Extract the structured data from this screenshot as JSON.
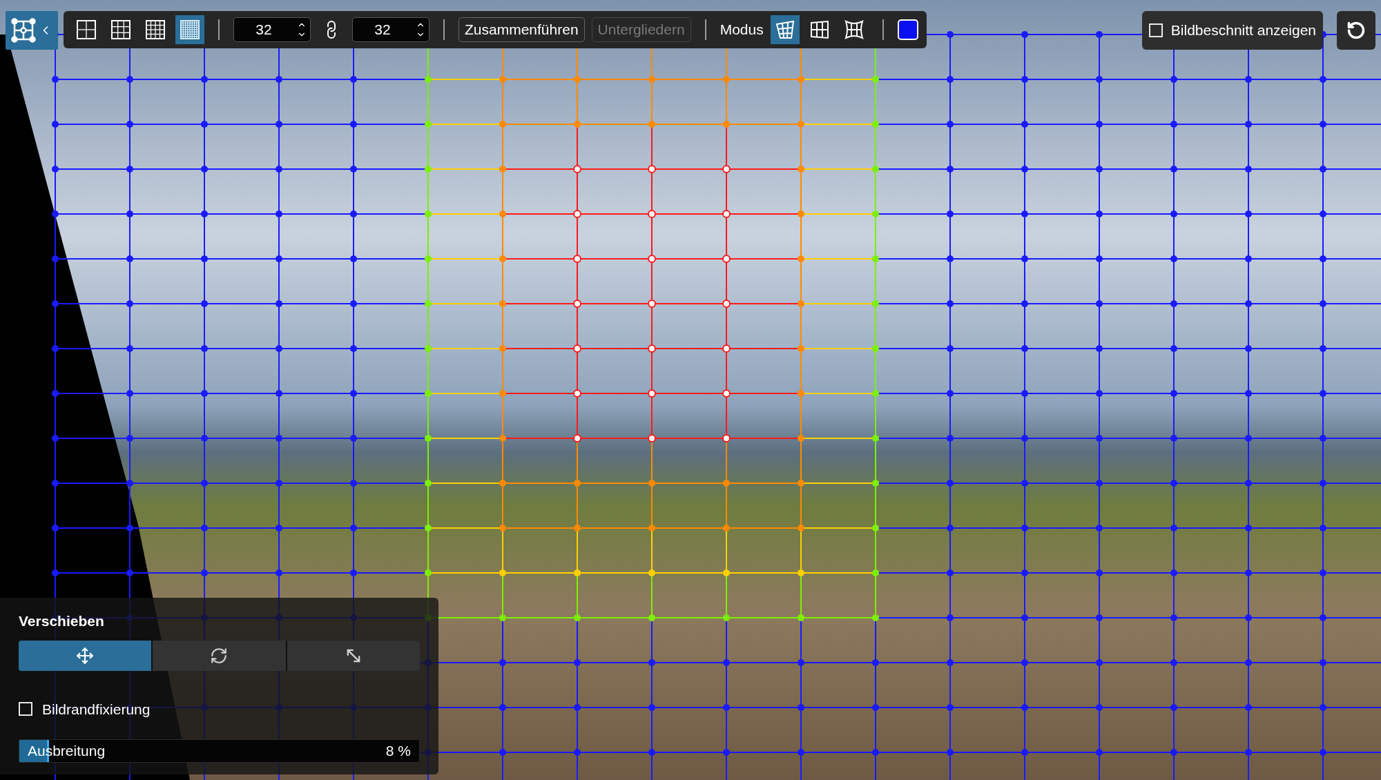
{
  "toolbar": {
    "mesh_tool": {
      "selected": true
    },
    "grid_presets": [
      {
        "selected": false
      },
      {
        "selected": false
      },
      {
        "selected": false
      },
      {
        "selected": true
      }
    ],
    "columns": {
      "value": "32"
    },
    "rows_linked": true,
    "rows": {
      "value": "32"
    },
    "buttons": [
      {
        "label": "Zusammenführen",
        "disabled": false
      },
      {
        "label": "Untergliedern",
        "disabled": true
      }
    ],
    "mode_label": "Modus",
    "modes": [
      {
        "kind": "perspective",
        "selected": true
      },
      {
        "kind": "grid",
        "selected": false
      },
      {
        "kind": "bulge",
        "selected": false
      }
    ],
    "grid_color": {
      "color": "#0a10f0"
    }
  },
  "crop_toggle": {
    "label": "Bildbeschnitt anzeigen",
    "checked": false
  },
  "panel": {
    "title": "Verschieben",
    "tools": [
      {
        "kind": "move",
        "selected": true
      },
      {
        "kind": "rotate",
        "selected": false
      },
      {
        "kind": "scale",
        "selected": false
      }
    ],
    "edge_lock": {
      "label": "Bildrandfixierung",
      "checked": false
    },
    "spread": {
      "label": "Ausbreitung",
      "level": 0.075,
      "reading": "8 %"
    }
  }
}
